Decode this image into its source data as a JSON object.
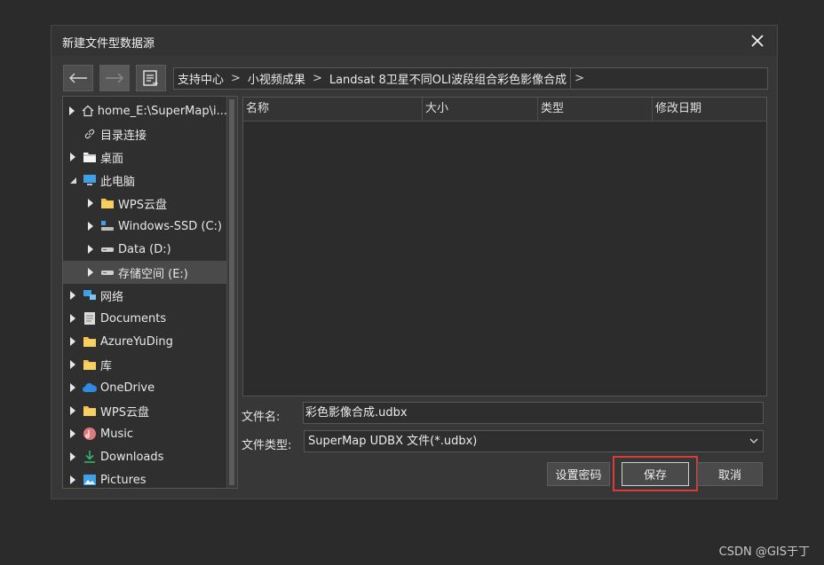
{
  "dialog": {
    "title": "新建文件型数据源"
  },
  "nav": {
    "back": "back",
    "forward": "forward",
    "history": "recent-locations"
  },
  "breadcrumb": {
    "items": [
      "支持中心",
      "小视频成果",
      "Landsat 8卫星不同OLI波段组合彩色影像合成"
    ],
    "separator": ">"
  },
  "tree": {
    "items": [
      {
        "label": "home_E:\\SuperMap\\i...",
        "icon": "home-icon",
        "expandable": true,
        "expanded": false,
        "level": 0
      },
      {
        "label": "目录连接",
        "icon": "link-icon",
        "expandable": false,
        "expanded": false,
        "level": 0
      },
      {
        "label": "桌面",
        "icon": "desktop-folder-icon",
        "expandable": true,
        "expanded": false,
        "level": 0
      },
      {
        "label": "此电脑",
        "icon": "computer-icon",
        "expandable": true,
        "expanded": true,
        "level": 0
      },
      {
        "label": "WPS云盘",
        "icon": "folder-icon",
        "expandable": true,
        "expanded": false,
        "level": 1
      },
      {
        "label": "Windows-SSD (C:)",
        "icon": "system-drive-icon",
        "expandable": true,
        "expanded": false,
        "level": 1
      },
      {
        "label": "Data (D:)",
        "icon": "drive-icon",
        "expandable": true,
        "expanded": false,
        "level": 1
      },
      {
        "label": "存储空间 (E:)",
        "icon": "drive-icon",
        "expandable": true,
        "expanded": false,
        "level": 1,
        "selected": true
      },
      {
        "label": "网络",
        "icon": "network-icon",
        "expandable": true,
        "expanded": false,
        "level": 0
      },
      {
        "label": "Documents",
        "icon": "documents-icon",
        "expandable": true,
        "expanded": false,
        "level": 0
      },
      {
        "label": "AzureYuDing",
        "icon": "folder-icon",
        "expandable": true,
        "expanded": false,
        "level": 0
      },
      {
        "label": "库",
        "icon": "folder-icon",
        "expandable": true,
        "expanded": false,
        "level": 0
      },
      {
        "label": "OneDrive",
        "icon": "cloud-icon",
        "expandable": true,
        "expanded": false,
        "level": 0
      },
      {
        "label": "WPS云盘",
        "icon": "folder-icon",
        "expandable": true,
        "expanded": false,
        "level": 0
      },
      {
        "label": "Music",
        "icon": "music-icon",
        "expandable": true,
        "expanded": false,
        "level": 0
      },
      {
        "label": "Downloads",
        "icon": "download-icon",
        "expandable": true,
        "expanded": false,
        "level": 0
      },
      {
        "label": "Pictures",
        "icon": "pictures-icon",
        "expandable": true,
        "expanded": false,
        "level": 0
      }
    ]
  },
  "file_list": {
    "columns": [
      "名称",
      "大小",
      "类型",
      "修改日期"
    ],
    "rows": []
  },
  "form": {
    "filename_label": "文件名:",
    "filename_value": "彩色影像合成.udbx",
    "filetype_label": "文件类型:",
    "filetype_value": "SuperMap UDBX 文件(*.udbx)"
  },
  "buttons": {
    "set_password": "设置密码",
    "save": "保存",
    "cancel": "取消"
  },
  "colors": {
    "highlight": "#d93a3a",
    "folder": "#f2c14e",
    "selected": "#4a4a4a"
  },
  "watermark": "CSDN @GIS于丁"
}
